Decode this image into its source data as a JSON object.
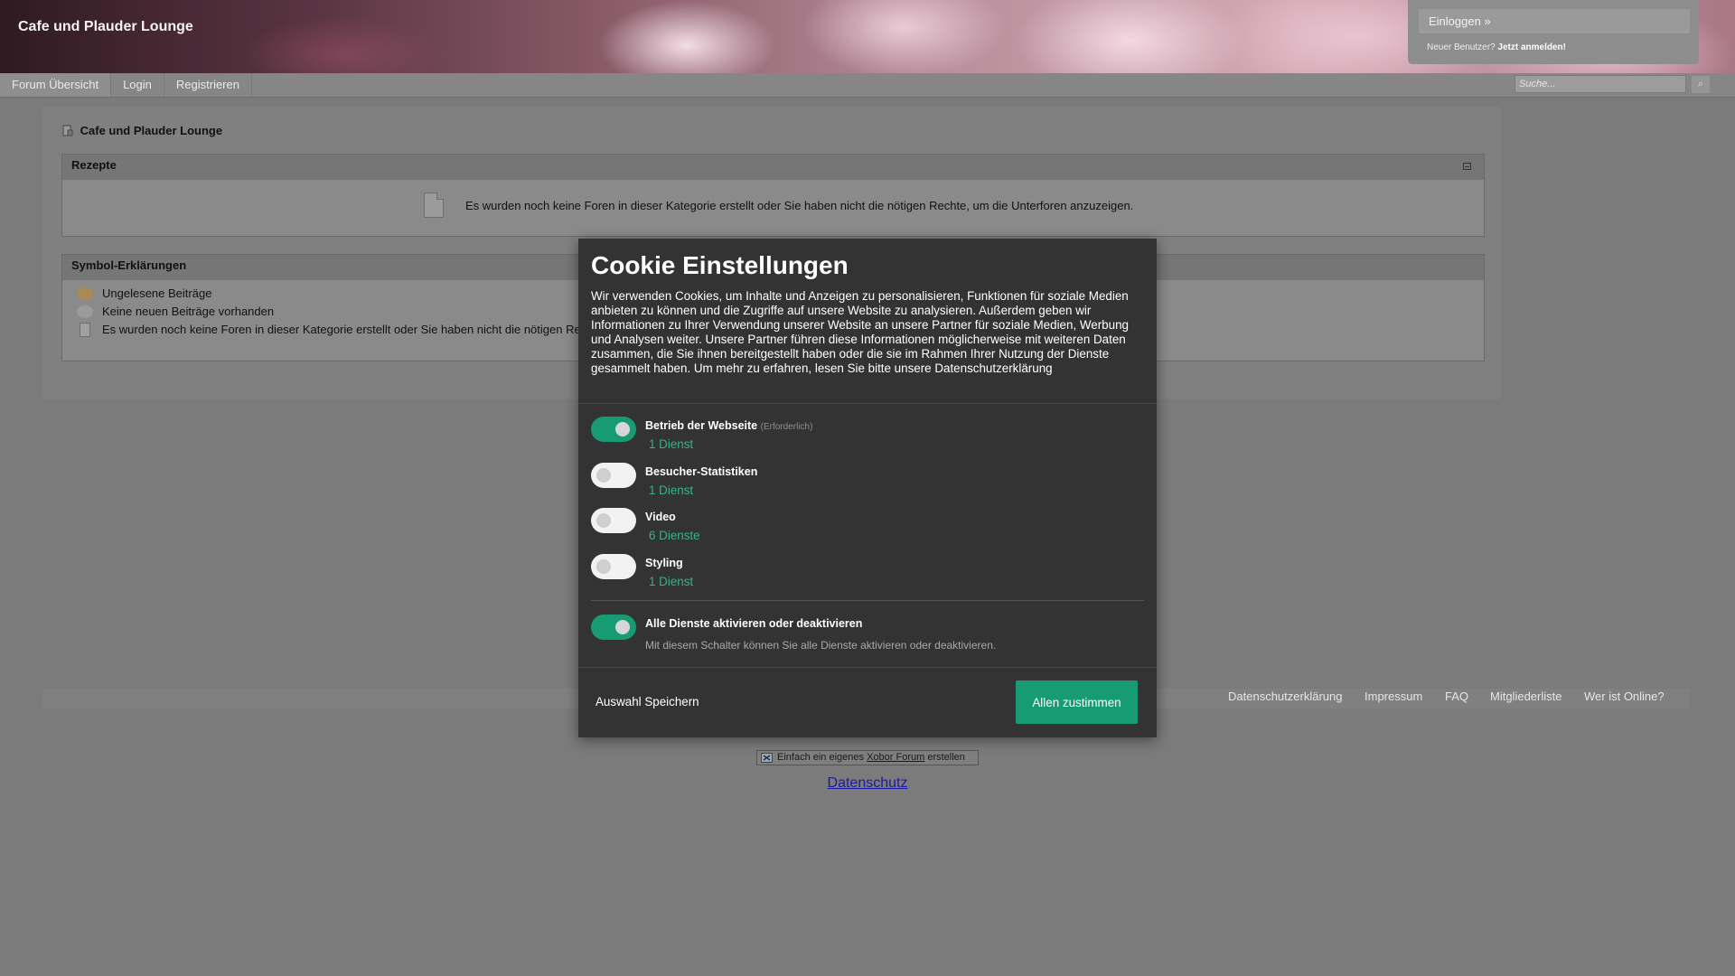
{
  "header": {
    "site_title": "Cafe und Plauder Lounge",
    "login_link": "Einloggen »",
    "new_user_prefix": "Neuer Benutzer?",
    "register_now": "Jetzt anmelden!"
  },
  "nav": {
    "items": [
      "Forum Übersicht",
      "Login",
      "Registrieren"
    ],
    "search_placeholder": "Suche...",
    "search_button": "⌕"
  },
  "breadcrumb": "Cafe und Plauder Lounge",
  "category": {
    "title": "Rezepte",
    "empty_message": "Es wurden noch keine Foren in dieser Kategorie erstellt oder Sie haben nicht die nötigen Rechte, um die Unterforen anzuzeigen."
  },
  "legend": {
    "title": "Symbol-Erklärungen",
    "items": [
      "Ungelesene Beiträge",
      "Keine neuen Beiträge vorhanden",
      "Es wurden noch keine Foren in dieser Kategorie erstellt oder Sie haben nicht die nötigen Rechte, um die Unterforen anzuzeigen."
    ]
  },
  "footer": {
    "links": [
      "Datenschutzerklärung",
      "Impressum",
      "FAQ",
      "Mitgliederliste",
      "Wer ist Online?"
    ],
    "powered_pre": "Einfach ein eigenes",
    "powered_link": "Xobor Forum",
    "powered_post": "erstellen",
    "privacy": "Datenschutz"
  },
  "cookie": {
    "title": "Cookie Einstellungen",
    "intro": "Wir verwenden Cookies, um Inhalte und Anzeigen zu personalisieren, Funktionen für soziale Medien anbieten zu können und die Zugriffe auf unsere Website zu analysieren. Außerdem geben wir Informationen zu Ihrer Verwendung unserer Website an unsere Partner für soziale Medien, Werbung und Analysen weiter. Unsere Partner führen diese Informationen möglicherweise mit weiteren Daten zusammen, die Sie ihnen bereitgestellt haben oder die sie im Rahmen Ihrer Nutzung der Dienste gesammelt haben. Um mehr zu erfahren, lesen Sie bitte unsere Datenschutzerklärung",
    "services": [
      {
        "name": "Betrieb der Webseite",
        "required": "(Erforderlich)",
        "count": "1 Dienst",
        "enabled": true
      },
      {
        "name": "Besucher-Statistiken",
        "required": "",
        "count": "1 Dienst",
        "enabled": false
      },
      {
        "name": "Video",
        "required": "",
        "count": "6 Dienste",
        "enabled": false
      },
      {
        "name": "Styling",
        "required": "",
        "count": "1 Dienst",
        "enabled": false
      }
    ],
    "all_toggle_label": "Alle Dienste aktivieren oder deaktivieren",
    "all_toggle_desc": "Mit diesem Schalter können Sie alle Dienste aktivieren oder deaktivieren.",
    "all_enabled": true,
    "save_label": "Auswahl Speichern",
    "accept_label": "Allen zustimmen",
    "accent_color": "#179b73"
  }
}
